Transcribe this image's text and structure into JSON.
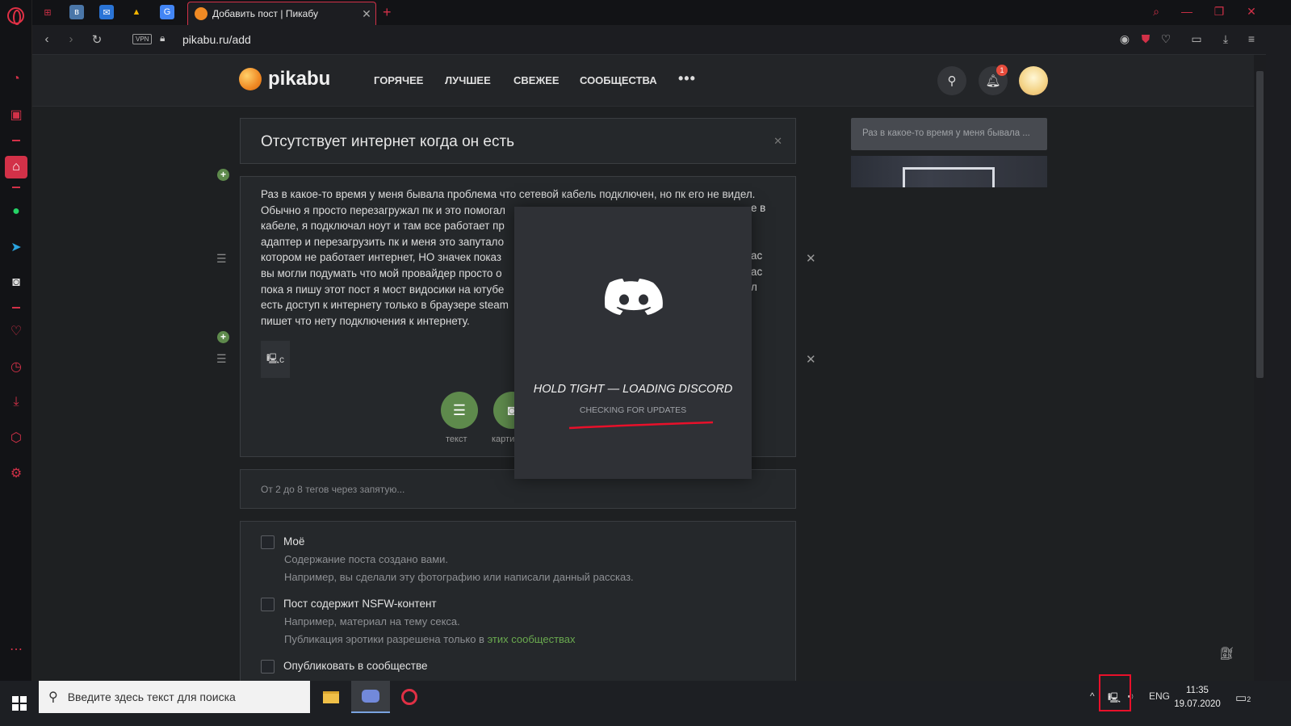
{
  "browser": {
    "active_tab_title": "Добавить пост | Пикабу",
    "url": "pikabu.ru/add",
    "vpn_label": "VPN",
    "pinned_tabs": [
      "game-controller-icon",
      "vk-icon",
      "mail-icon",
      "drive-icon",
      "translate-icon"
    ]
  },
  "site": {
    "logo_text": "pikabu",
    "nav": [
      "ГОРЯЧЕЕ",
      "ЛУЧШЕЕ",
      "СВЕЖЕЕ",
      "СООБЩЕСТВА"
    ],
    "nav_more": "•••",
    "notification_count": "1"
  },
  "post": {
    "title": "Отсутствует интернет когда он есть",
    "body_lines": [
      "Раз в какое-то время у меня бывала проблема что сетевой кабель подключен, но пк его не видел.",
      "Обычно я просто перезагружал пк и это помогал",
      "кабеле, я подключал ноут и там все работает пр",
      "адаптер и перезагрузить пк и меня это запутало",
      "котором не работает интернет, НО значек показ",
      "вы могли подумать что мой провайдер просто о",
      "пока я пишу этот пост я мост видосики на ютубе",
      "есть доступ к интернету только в браузере steam",
      "пишет что нету подключения к интернету."
    ],
    "body_tail_right": [
      "е в",
      "ас",
      "ас",
      "л"
    ],
    "image_chip_label": "с",
    "add_text_label": "текст",
    "add_image_label": "карти"
  },
  "tags": {
    "placeholder": "От 2 до 8 тегов через запятую..."
  },
  "options": {
    "mine_label": "Моё",
    "mine_desc1": "Содержание поста создано вами.",
    "mine_desc2": "Например, вы сделали эту фотографию или написали данный рассказ.",
    "nsfw_label": "Пост содержит NSFW-контент",
    "nsfw_desc1": "Например, материал на тему секса.",
    "nsfw_desc2_prefix": "Публикация эротики разрешена только в ",
    "nsfw_desc2_link": "этих сообществах",
    "community_label": "Опубликовать в сообществе"
  },
  "preview": {
    "text": "Раз в какое-то время у меня бывала ..."
  },
  "discord": {
    "title": "HOLD TIGHT — LOADING DISCORD",
    "subtitle": "CHECKING FOR UPDATES"
  },
  "taskbar": {
    "search_placeholder": "Введите здесь текст для поиска",
    "lang": "ENG",
    "time": "11:35",
    "date": "19.07.2020",
    "notif_count": "2"
  },
  "colors": {
    "accent": "#d23148",
    "green": "#5e8a4c",
    "link": "#6aaa4f",
    "discord_bg": "#2f3136"
  }
}
